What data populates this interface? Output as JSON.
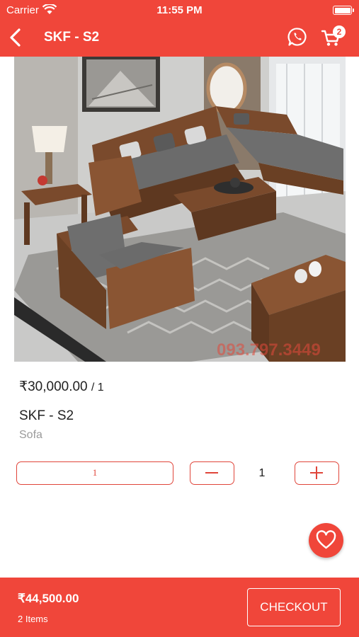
{
  "status": {
    "carrier": "Carrier",
    "time": "11:55 PM"
  },
  "header": {
    "title": "SKF - S2",
    "cart_count": "2",
    "color": "#f0463a"
  },
  "product": {
    "price": "₹30,000.00",
    "price_unit": "/ 1",
    "name": "SKF - S2",
    "category": "Sofa",
    "watermark": "093.797.3449"
  },
  "quantity": {
    "field_value": "1",
    "value": "1"
  },
  "footer": {
    "total": "₹44,500.00",
    "items": "2 Items",
    "checkout_label": "CHECKOUT"
  }
}
